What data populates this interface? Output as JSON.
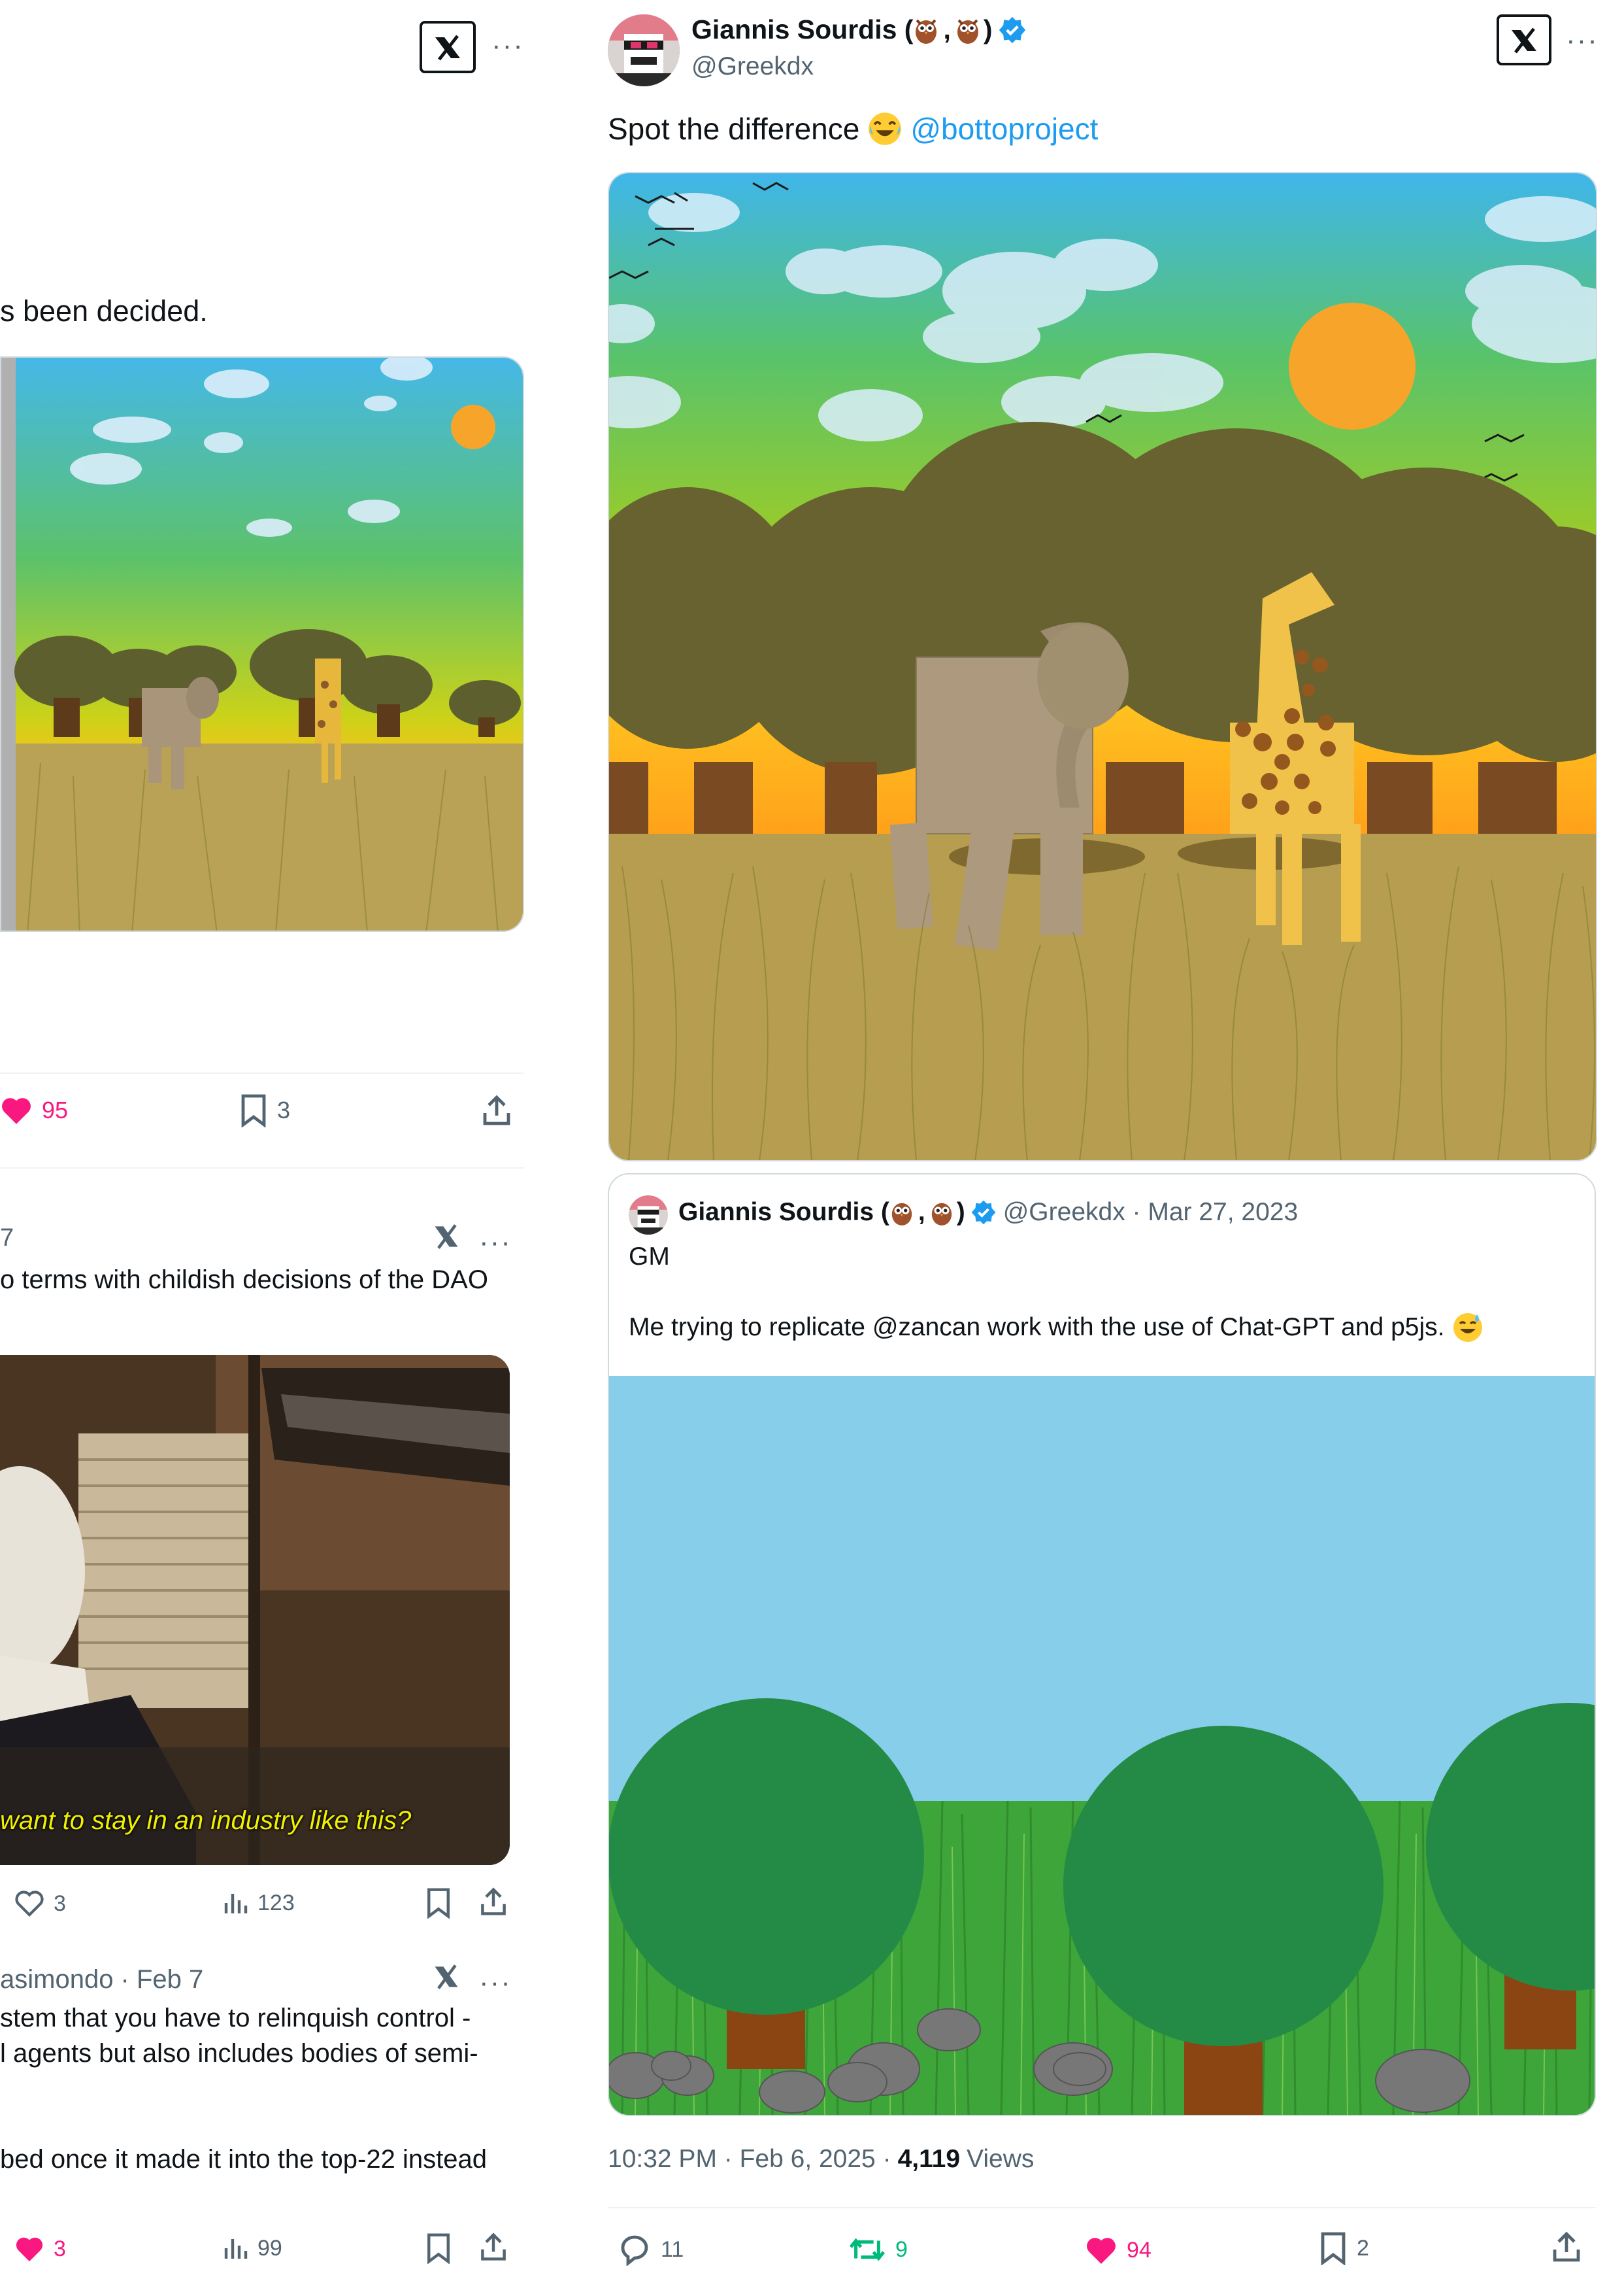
{
  "left": {
    "tweet1": {
      "text_fragment": "s been decided.",
      "likes": "95",
      "bookmarks": "3"
    },
    "tweet2": {
      "date_fragment": "7",
      "text_fragment": "o terms with childish decisions of the DAO",
      "video_caption": "want to stay in an industry like this?",
      "likes": "3",
      "views": "123"
    },
    "tweet3": {
      "author_fragment": "asimondo · Feb 7",
      "line1": "stem that you have to relinquish control -",
      "line2": "l agents but also includes bodies of semi-",
      "line3": "bed once it made it into the top-22 instead",
      "likes": "3",
      "views": "99"
    }
  },
  "main": {
    "author_name": "Giannis Sourdis (",
    "author_sep": ",",
    "author_close": ")",
    "handle": "@Greekdx",
    "text_before": "Spot the difference",
    "mention": "@bottoproject",
    "quote": {
      "author_name": "Giannis Sourdis (",
      "author_sep": ",",
      "author_close": ")",
      "handle_date": "@Greekdx · Mar 27, 2023",
      "line1": "GM",
      "line2": "Me trying to replicate @zancan work with the use of Chat-GPT and p5js."
    },
    "timestamp": "10:32 PM · Feb 6, 2025 ·",
    "views_count": "4,119",
    "views_label": "Views",
    "replies": "11",
    "retweets": "9",
    "likes": "94",
    "bookmarks": "2"
  },
  "colors": {
    "accent": "#1d9bf0",
    "like": "#f91880",
    "retweet": "#00ba7c",
    "muted": "#536471"
  },
  "icons": [
    "x-logo-icon",
    "more-icon",
    "verified-badge-icon",
    "heart-icon",
    "bookmark-icon",
    "share-icon",
    "reply-icon",
    "retweet-icon",
    "views-icon",
    "owl-emoji-icon",
    "laugh-emoji-icon",
    "sweat-smile-emoji-icon"
  ]
}
